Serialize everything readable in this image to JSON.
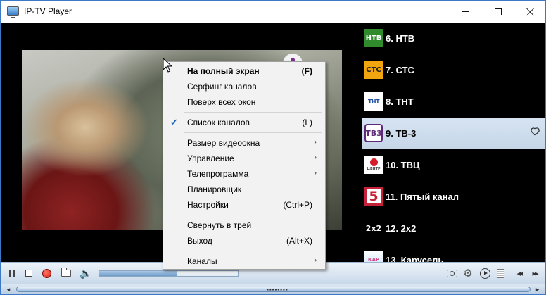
{
  "window": {
    "title": "IP-TV Player"
  },
  "channels": [
    {
      "label": "6. НТВ",
      "logo_text": "НТВ",
      "selected": false
    },
    {
      "label": "7. СТС",
      "logo_text": "СТС",
      "selected": false
    },
    {
      "label": "8. ТНТ",
      "logo_text": "ТНТ",
      "selected": false
    },
    {
      "label": "9. ТВ-3",
      "logo_text": "ТВ3",
      "selected": true
    },
    {
      "label": "10. ТВЦ",
      "logo_text": "ЦЕНТР",
      "selected": false
    },
    {
      "label": "11. Пятый канал",
      "logo_text": "5",
      "selected": false
    },
    {
      "label": "12. 2х2",
      "logo_text": "2x2",
      "selected": false
    },
    {
      "label": "13. Карусель",
      "logo_text": "КАР",
      "selected": false
    }
  ],
  "context_menu": {
    "items": [
      {
        "label": "На полный экран",
        "shortcut": "(F)"
      },
      {
        "label": "Серфинг каналов"
      },
      {
        "label": "Поверх всех окон"
      },
      {
        "label": "Список каналов",
        "shortcut": "(L)",
        "checked": true
      },
      {
        "label": "Размер видеоокна",
        "submenu": "›"
      },
      {
        "label": "Управление",
        "submenu": "›"
      },
      {
        "label": "Телепрограмма",
        "submenu": "›"
      },
      {
        "label": "Планировщик"
      },
      {
        "label": "Настройки",
        "shortcut": "(Ctrl+P)"
      },
      {
        "label": "Свернуть в трей"
      },
      {
        "label": "Выход",
        "shortcut": "(Alt+X)"
      },
      {
        "label": "Каналы",
        "submenu": "›"
      }
    ]
  },
  "controls": {
    "volume_level": 0.56
  },
  "icons": {
    "check": "✔",
    "speaker": "🔈",
    "gear": "⚙",
    "prev": "◂◂",
    "next": "▸▸",
    "scroll_left": "◂",
    "scroll_right": "▸",
    "grip": "▪▪▪▪▪▪▪▪"
  },
  "colors": {
    "accent": "#3b79c5",
    "selected_row": "#c6d6e8",
    "record": "#d51b10"
  }
}
